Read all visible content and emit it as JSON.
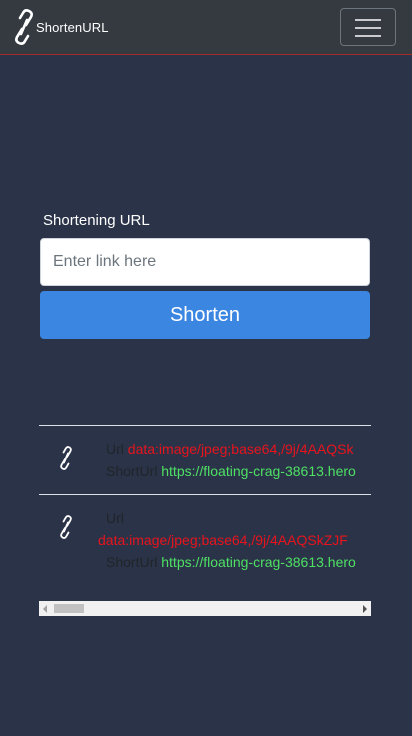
{
  "navbar": {
    "brand": "ShortenURL",
    "brand_icon": "link-icon",
    "toggler_icon": "hamburger-menu-icon"
  },
  "form": {
    "label": "Shortening URL",
    "input_placeholder": "Enter link here",
    "input_value": "",
    "submit_label": "Shorten"
  },
  "links": {
    "url_label": "Url",
    "short_label": "ShortUrl",
    "items": [
      {
        "icon": "link-icon",
        "url": "data:image/jpeg;base64,/9j/4AAQSk",
        "short_url": "https://floating-crag-38613.hero"
      },
      {
        "icon": "link-icon",
        "url": "data:image/jpeg;base64,/9j/4AAQSkZJF",
        "short_url": "https://floating-crag-38613.hero"
      }
    ]
  },
  "colors": {
    "background": "#2a3348",
    "navbar": "#343a40",
    "primary_button": "#3a86e0",
    "url_text": "#e8141d",
    "short_url_text": "#4fe064"
  }
}
